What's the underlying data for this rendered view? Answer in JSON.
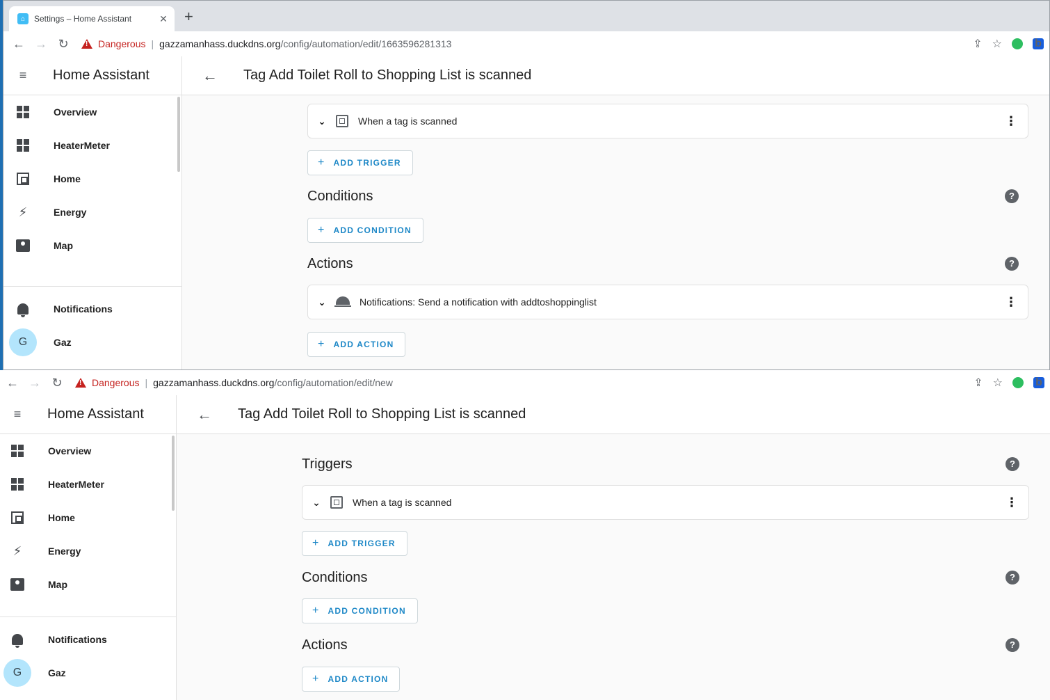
{
  "browser1": {
    "tab_title": "Settings – Home Assistant",
    "tab_close": "✕",
    "new_tab": "+",
    "security": "Dangerous",
    "url_host": "gazzamanhass.duckdns.org",
    "url_path": "/config/automation/edit/1663596281313"
  },
  "browser2": {
    "security": "Dangerous",
    "url_host": "gazzamanhass.duckdns.org",
    "url_path": "/config/automation/edit/new"
  },
  "app": {
    "title": "Home Assistant",
    "sidebar": [
      {
        "label": "Overview",
        "icon": "dashboard-icon"
      },
      {
        "label": "HeaterMeter",
        "icon": "dashboard-icon"
      },
      {
        "label": "Home",
        "icon": "floorplan-icon"
      },
      {
        "label": "Energy",
        "icon": "lightning-icon"
      },
      {
        "label": "Map",
        "icon": "map-icon"
      }
    ],
    "notifications": "Notifications",
    "user_initial": "G",
    "user_name": "Gaz"
  },
  "page_title": "Tag Add Toilet Roll to Shopping List is scanned",
  "sections": {
    "triggers": "Triggers",
    "conditions": "Conditions",
    "actions": "Actions"
  },
  "trigger_card": "When a tag is scanned",
  "action_card": "Notifications: Send a notification with addtoshoppinglist",
  "buttons": {
    "add_trigger": "ADD TRIGGER",
    "add_condition": "ADD CONDITION",
    "add_action": "ADD ACTION"
  },
  "colors": {
    "accent": "#1e88c7",
    "danger": "#c5221f"
  }
}
